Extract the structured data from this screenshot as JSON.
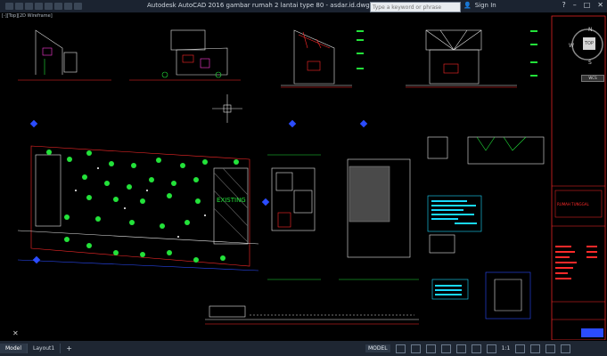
{
  "window": {
    "title": "Autodesk AutoCAD 2016    gambar rumah 2 lantai type 80 - asdar.id.dwg",
    "search_placeholder": "Type a keyword or phrase",
    "sign_in": "Sign In"
  },
  "viewport": {
    "label": "[-][Top][2D Wireframe]"
  },
  "viewcube": {
    "north": "N",
    "west": "W",
    "south": "S",
    "top": "TOP",
    "wcs": "WCS"
  },
  "drawing": {
    "existing_label": "EXISTING",
    "accent_colors": {
      "white": "#e6e6e6",
      "red": "#ff2a2a",
      "green": "#23e23a",
      "cyan": "#19d9ff",
      "yellow": "#ffe600",
      "magenta": "#ff3bd9",
      "blue": "#2b4cff"
    }
  },
  "title_block": {
    "project": "RUMAH TUNGGAL"
  },
  "statusbar": {
    "tabs": [
      "Model",
      "Layout1"
    ],
    "add_tab": "+",
    "model": "MODEL",
    "scale": "1:1"
  }
}
